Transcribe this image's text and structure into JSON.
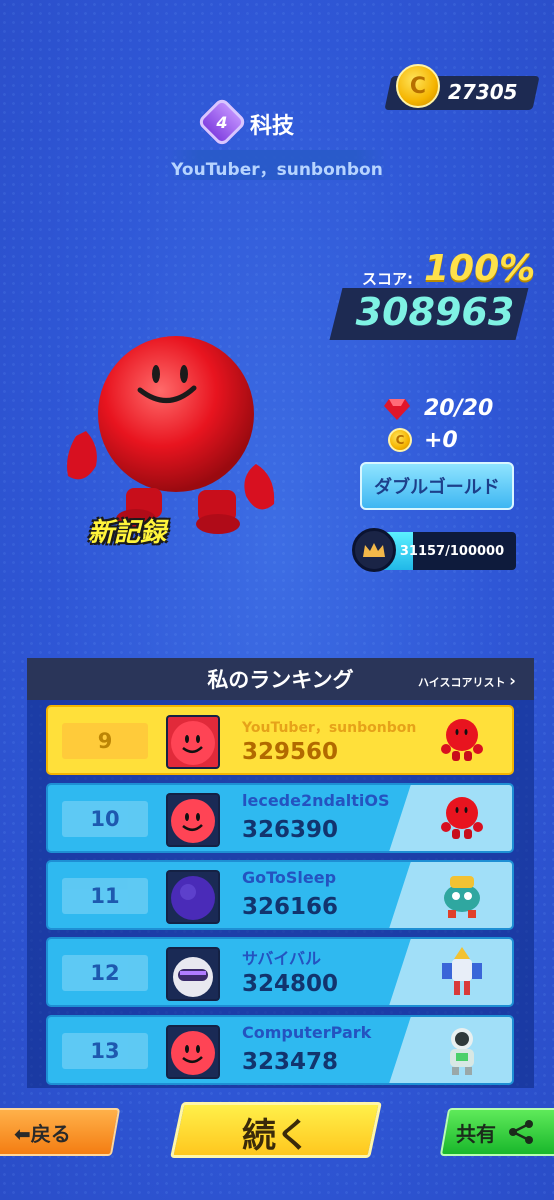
{
  "header": {
    "coins": "27305",
    "level": "4",
    "category": "科技",
    "song": "YouTuber，sunbonbon"
  },
  "result": {
    "score_label": "スコア:",
    "accuracy": "100%",
    "score": "308963",
    "gems": "20/20",
    "coin_gain": "+0",
    "double_gold": "ダブルゴールド",
    "xp": "31157/100000",
    "xp_progress": 0.3116,
    "new_record": "新記録"
  },
  "ranking": {
    "title": "私のランキング",
    "highscore_link": "ハイスコアリスト",
    "rows": [
      {
        "rank": "9",
        "name": "YouTuber，sunbonbon",
        "score": "329560"
      },
      {
        "rank": "10",
        "name": "lecede2ndaltiOS",
        "score": "326390"
      },
      {
        "rank": "11",
        "name": "GoToSleep",
        "score": "326166"
      },
      {
        "rank": "12",
        "name": "サバイバル",
        "score": "324800"
      },
      {
        "rank": "13",
        "name": "ComputerPark",
        "score": "323478"
      }
    ]
  },
  "footer": {
    "back": "戻る",
    "next": "続く",
    "share": "共有"
  },
  "colors": {
    "background": "#2f57d6",
    "highlight_row": "#ffe03a",
    "row": "#2fb9f0",
    "accent": "#ffe14a",
    "score": "#7ff2e4"
  }
}
